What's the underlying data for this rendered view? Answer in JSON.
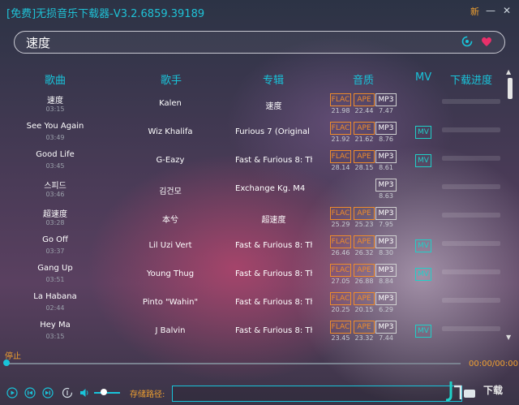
{
  "window": {
    "title": "[免费]无损音乐下载器-V3.2.6859.39189",
    "new_badge": "新",
    "minimize_glyph": "—",
    "close_glyph": "✕"
  },
  "search": {
    "value": "速度"
  },
  "columns": [
    "歌曲",
    "歌手",
    "专辑",
    "音质",
    "MV",
    "下载进度"
  ],
  "quality_labels": {
    "flac": "FLAC",
    "ape": "APE",
    "mp3": "MP3"
  },
  "mv_label": "MV",
  "rows": [
    {
      "song": "速度",
      "duration": "03:15",
      "artist": "Kalen",
      "album": "速度",
      "album_center": true,
      "flac": "21.98",
      "ape": "22.44",
      "mp3": "7.47",
      "mv": false
    },
    {
      "song": "See You Again",
      "duration": "03:49",
      "artist": "Wiz Khalifa",
      "album": "Furious 7 (Original Motion Picture Soundtrack)",
      "album_center": false,
      "flac": "21.92",
      "ape": "21.62",
      "mp3": "8.76",
      "mv": true
    },
    {
      "song": "Good Life",
      "duration": "03:45",
      "artist": "G-Eazy",
      "album": "Fast & Furious 8: The Album",
      "album_center": false,
      "flac": "28.14",
      "ape": "28.15",
      "mp3": "8.61",
      "mv": true
    },
    {
      "song": "스피드",
      "duration": "03:46",
      "artist": "김건모",
      "album": "Exchange Kg. M4",
      "album_center": false,
      "flac": null,
      "ape": null,
      "mp3": "8.63",
      "mv": false
    },
    {
      "song": "超速度",
      "duration": "03:28",
      "artist": "本兮",
      "album": "超速度",
      "album_center": true,
      "flac": "25.29",
      "ape": "25.23",
      "mp3": "7.95",
      "mv": false
    },
    {
      "song": "Go Off",
      "duration": "03:37",
      "artist": "Lil Uzi Vert",
      "album": "Fast & Furious 8: The Album",
      "album_center": false,
      "flac": "26.46",
      "ape": "26.32",
      "mp3": "8.30",
      "mv": true
    },
    {
      "song": "Gang Up",
      "duration": "03:51",
      "artist": "Young Thug",
      "album": "Fast & Furious 8: The Album",
      "album_center": false,
      "flac": "27.05",
      "ape": "26.88",
      "mp3": "8.84",
      "mv": true
    },
    {
      "song": "La Habana",
      "duration": "02:44",
      "artist": "Pinto \"Wahin\"",
      "album": "Fast & Furious 8: The Album",
      "album_center": false,
      "flac": "20.25",
      "ape": "20.15",
      "mp3": "6.29",
      "mv": false
    },
    {
      "song": "Hey Ma",
      "duration": "03:15",
      "artist": "J Balvin",
      "album": "Fast & Furious 8: The Album",
      "album_center": false,
      "flac": "23.45",
      "ape": "23.32",
      "mp3": "7.44",
      "mv": true
    }
  ],
  "player": {
    "status": "停止",
    "time": "00:00/00:00",
    "save_path_label": "存储路径:",
    "save_path_value": "",
    "volume_level": 0.4
  },
  "watermark": {
    "text": "下载"
  },
  "colors": {
    "accent": "#19c4da",
    "orange": "#f0a030",
    "mv": "#1fd0c8"
  }
}
